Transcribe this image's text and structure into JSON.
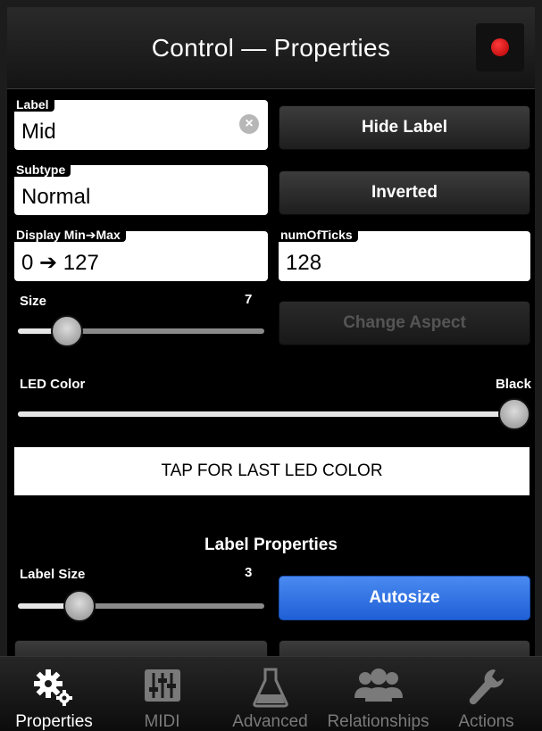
{
  "header": {
    "title": "Control — Properties"
  },
  "label_field": {
    "label": "Label",
    "value": "Mid"
  },
  "subtype_field": {
    "label": "Subtype",
    "value": "Normal"
  },
  "display_field": {
    "label": "Display Min➔Max",
    "value": "0 ➔ 127"
  },
  "ticks_field": {
    "label": "numOfTicks",
    "value": "128"
  },
  "buttons": {
    "hide_label": "Hide Label",
    "inverted": "Inverted",
    "change_aspect": "Change Aspect",
    "autosize": "Autosize"
  },
  "size_slider": {
    "label": "Size",
    "value": "7",
    "level": 0.2
  },
  "led_slider": {
    "label": "LED Color",
    "value": "Black",
    "level": 1.0
  },
  "tap_last_led": "TAP FOR LAST LED COLOR",
  "label_properties": {
    "title": "Label Properties",
    "size_label": "Label Size",
    "size_value": "3",
    "size_level": 0.25
  },
  "tabs": [
    {
      "label": "Properties",
      "icon": "gears-icon",
      "active": true
    },
    {
      "label": "MIDI",
      "icon": "mixer-icon",
      "active": false
    },
    {
      "label": "Advanced",
      "icon": "flask-icon",
      "active": false
    },
    {
      "label": "Relationships",
      "icon": "people-icon",
      "active": false
    },
    {
      "label": "Actions",
      "icon": "wrench-icon",
      "active": false
    }
  ],
  "colors": {
    "accent_blue": "#2f6fe0",
    "record_red": "#e00000"
  }
}
